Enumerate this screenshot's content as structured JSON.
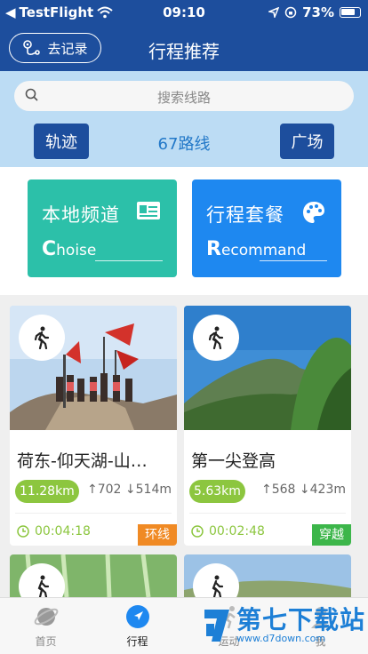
{
  "status": {
    "carrier": "TestFlight",
    "time": "09:10",
    "battery": "73%"
  },
  "nav": {
    "back_label": "去记录",
    "title": "行程推荐"
  },
  "search": {
    "placeholder": "搜索线路"
  },
  "filters": {
    "left": "轨迹",
    "count": "67路线",
    "right": "广场"
  },
  "channels": [
    {
      "title": "本地频道",
      "first": "C",
      "rest": "hoise",
      "color": "#2cc0a9",
      "icon": "id-card-icon"
    },
    {
      "title": "行程套餐",
      "first": "R",
      "rest": "ecommand",
      "color": "#1e88f0",
      "icon": "palette-icon"
    }
  ],
  "routes": [
    {
      "name": "荷东-仰天湖-山…",
      "distance": "11.28km",
      "ascent": "702",
      "descent": "514m",
      "duration": "00:04:18",
      "type": "环线",
      "type_color": "#f08a24"
    },
    {
      "name": "第一尖登高",
      "distance": "5.63km",
      "ascent": "568",
      "descent": "423m",
      "duration": "00:02:48",
      "type": "穿越",
      "type_color": "#3cb64a"
    }
  ],
  "tabs": [
    {
      "label": "首页",
      "icon": "planet-icon"
    },
    {
      "label": "行程",
      "icon": "compass-icon"
    },
    {
      "label": "运动",
      "icon": "run-icon"
    },
    {
      "label": "我",
      "icon": "user-icon"
    }
  ],
  "watermark": {
    "text": "第七下载站",
    "url": "www.d7down.com"
  }
}
